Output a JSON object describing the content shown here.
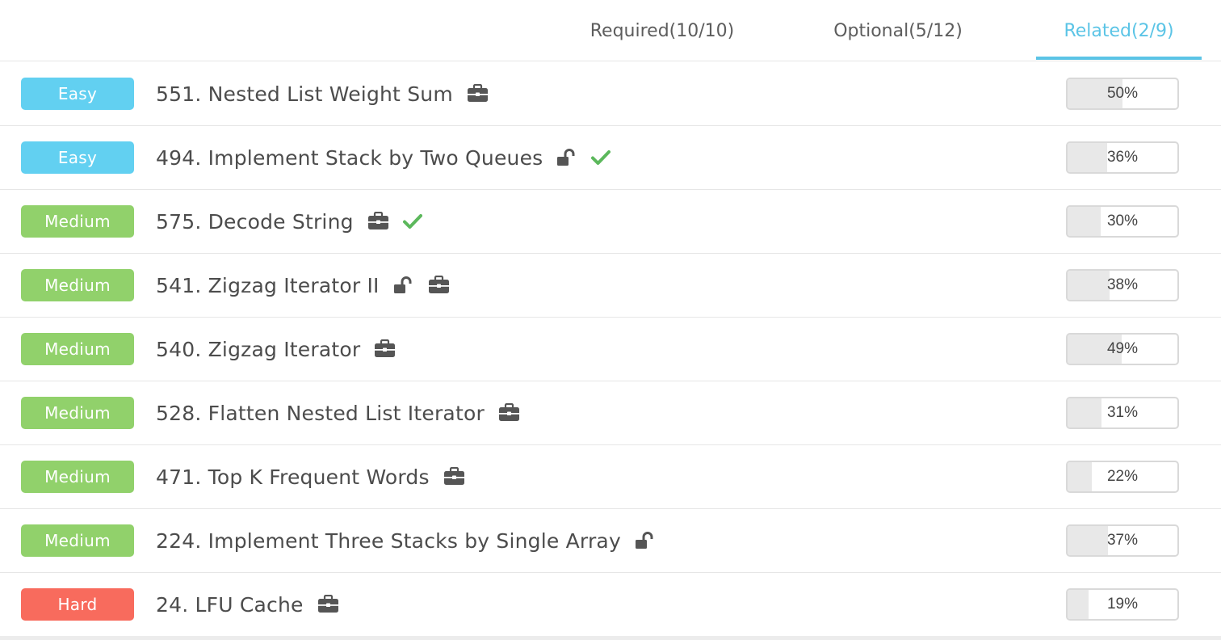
{
  "tabs": [
    {
      "label": "Required(10/10)",
      "active": false
    },
    {
      "label": "Optional(5/12)",
      "active": false
    },
    {
      "label": "Related(2/9)",
      "active": true
    }
  ],
  "colors": {
    "accent": "#5bc4e6",
    "easy": "#62d0f1",
    "medium": "#91d16b",
    "hard": "#f86b5d",
    "check": "#5cb85c",
    "icon": "#555555"
  },
  "problems": [
    {
      "difficulty": "Easy",
      "title": "551. Nested List Weight Sum",
      "locked_open": false,
      "company": true,
      "solved": false,
      "pass_rate": "50%",
      "pass_value": 0.5
    },
    {
      "difficulty": "Easy",
      "title": "494. Implement Stack by Two Queues",
      "locked_open": true,
      "company": false,
      "solved": true,
      "pass_rate": "36%",
      "pass_value": 0.36
    },
    {
      "difficulty": "Medium",
      "title": "575. Decode String",
      "locked_open": false,
      "company": true,
      "solved": true,
      "pass_rate": "30%",
      "pass_value": 0.3
    },
    {
      "difficulty": "Medium",
      "title": "541. Zigzag Iterator II",
      "locked_open": true,
      "company": true,
      "solved": false,
      "pass_rate": "38%",
      "pass_value": 0.38
    },
    {
      "difficulty": "Medium",
      "title": "540. Zigzag Iterator",
      "locked_open": false,
      "company": true,
      "solved": false,
      "pass_rate": "49%",
      "pass_value": 0.49
    },
    {
      "difficulty": "Medium",
      "title": "528. Flatten Nested List Iterator",
      "locked_open": false,
      "company": true,
      "solved": false,
      "pass_rate": "31%",
      "pass_value": 0.31
    },
    {
      "difficulty": "Medium",
      "title": "471. Top K Frequent Words",
      "locked_open": false,
      "company": true,
      "solved": false,
      "pass_rate": "22%",
      "pass_value": 0.22
    },
    {
      "difficulty": "Medium",
      "title": "224. Implement Three Stacks by Single Array",
      "locked_open": true,
      "company": false,
      "solved": false,
      "pass_rate": "37%",
      "pass_value": 0.37
    },
    {
      "difficulty": "Hard",
      "title": "24. LFU Cache",
      "locked_open": false,
      "company": true,
      "solved": false,
      "pass_rate": "19%",
      "pass_value": 0.19
    }
  ]
}
